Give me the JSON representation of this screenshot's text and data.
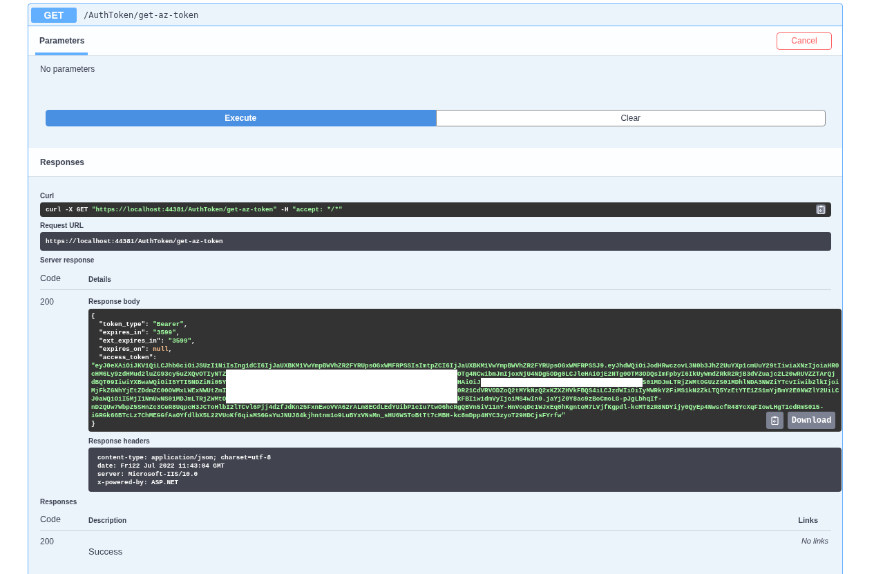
{
  "operation": {
    "method": "GET",
    "path": "/AuthToken/get-az-token"
  },
  "tabs": [
    {
      "label": "Parameters",
      "selected": true
    }
  ],
  "cancel_button": "Cancel",
  "parameters_note": "No parameters",
  "actions": [
    {
      "label": "Execute",
      "kind": "primary"
    },
    {
      "label": "Clear",
      "kind": "secondary"
    }
  ],
  "responses_heading": "Responses",
  "curl": {
    "label": "Curl",
    "parts": [
      {
        "kind": "plain",
        "text": "curl -X GET "
      },
      {
        "kind": "string",
        "text": "\"https://localhost:44381/AuthToken/get-az-token\""
      },
      {
        "kind": "plain",
        "text": " -H  "
      },
      {
        "kind": "string",
        "text": "\"accept: */*\""
      }
    ]
  },
  "request_url": {
    "label": "Request URL",
    "value": "https://localhost:44381/AuthToken/get-az-token"
  },
  "server_response": {
    "label": "Server response",
    "columns": [
      "Code",
      "Details"
    ],
    "code": "200",
    "body_label": "Response body",
    "body_lines": [
      [
        {
          "kind": "punct",
          "text": "{"
        }
      ],
      [
        {
          "kind": "key",
          "text": "  \"token_type\""
        },
        {
          "kind": "punct",
          "text": ": "
        },
        {
          "kind": "string",
          "text": "\"Bearer\""
        },
        {
          "kind": "punct",
          "text": ","
        }
      ],
      [
        {
          "kind": "key",
          "text": "  \"expires_in\""
        },
        {
          "kind": "punct",
          "text": ": "
        },
        {
          "kind": "string",
          "text": "\"3599\""
        },
        {
          "kind": "punct",
          "text": ","
        }
      ],
      [
        {
          "kind": "key",
          "text": "  \"ext_expires_in\""
        },
        {
          "kind": "punct",
          "text": ": "
        },
        {
          "kind": "string",
          "text": "\"3599\""
        },
        {
          "kind": "punct",
          "text": ","
        }
      ],
      [
        {
          "kind": "key",
          "text": "  \"expires_on\""
        },
        {
          "kind": "punct",
          "text": ": "
        },
        {
          "kind": "null",
          "text": "null"
        },
        {
          "kind": "punct",
          "text": ","
        }
      ],
      [
        {
          "kind": "key",
          "text": "  \"access_token\""
        },
        {
          "kind": "punct",
          "text": ":"
        }
      ],
      [
        {
          "kind": "string",
          "text": "\"eyJ0eXAiOiJKV1QiLCJhbGciOiJSUzI1NiIsIng1dCI6IjJaUXBKM1VwYmpBWVhZR2FYRUpsOGxWMFRPSSIsImtpZCI6IjJaUXBKM1VwYmpBWVhZR2FYRUpsOGxWMFRPSSJ9.eyJhdWQiOiJodHRwczovL3N0b3JhZ2UuYXp1cmUuY29tIiwiaXNzIjoiaHR0"
        }
      ],
      [
        {
          "kind": "string",
          "text": "cHM6Ly9zdHMud2luZG93cy5uZXQvOTIyNTZ"
        },
        {
          "kind": "redacted"
        },
        {
          "kind": "string",
          "text": "OTg4NCwibmJmIjoxNjU4NDg5ODg0LCJleHAiOjE2NTg0OTM3ODQsImFpbyI6IkUyWmdZRkR2RjB3dVZuajc2L20wRUVZZTArQj"
        }
      ],
      [
        {
          "kind": "string",
          "text": "dBQT09IiwiYXBwaWQiOiI5YTI5NDZiNi05Y"
        },
        {
          "kind": "redacted"
        },
        {
          "kind": "string",
          "text": "HAiOiJ"
        },
        {
          "kind": "redacted"
        },
        {
          "kind": "string",
          "text": "S01MDJmLTRjZWMtOGUzZS01MDhlNDA3NWZiYTcvIiwib2lkIjoi"
        }
      ],
      [
        {
          "kind": "string",
          "text": "MjFkZGNhYjEtZDdmZC00OWMxLWExNWUtZmI"
        },
        {
          "kind": "redacted"
        },
        {
          "kind": "string",
          "text": "0R21CdVRVODZoQ2tMYkNzQ2xKZXZHVkFBQS4iLCJzdWIiOiIyMWRkY2FiMS1kN2ZkLTQ5YzEtYTE1ZS1mYjBmY2E0NWZlY2UiLC"
        }
      ],
      [
        {
          "kind": "string",
          "text": "J0aWQiOiI5MjI1NmUwNS01MDJmLTRjZWMtO"
        },
        {
          "kind": "redacted"
        },
        {
          "kind": "string",
          "text": "kFBIiwidmVyIjoiMS4wIn0.jaYjZ0Y8ac9zBoCmoLG-pJgLbhqIf-"
        }
      ],
      [
        {
          "kind": "string",
          "text": "nD2QUw7WbpZ5SHnZc3CeR8UqpcH3JCToHlbI2lTCvl6Pjj4dzfJdKn25FxnEwoVVA62rALm8ECdLEdYUibP1cIu7twO6hcRgQBVn5iV11nY-HnVoqDc1WJxEq0hKgntoM7LVjfKgpdl-kcMT8zR8NDYijy0QyEp4NwscfR48YcXqFIowLHgT1cdRmS015-"
        }
      ],
      [
        {
          "kind": "string",
          "text": "iGRGk66BTcLz7ChMEGGfAaOYfdlbX5L22VUoKf6qisMS6GsYuJNUJ84kjhntnm1o9LuBYxVNsMn_sHU6WSToBtTt7cMBH-kc8mDpp4HYC3zyoT29HDCjsFYrfw\""
        }
      ],
      [
        {
          "kind": "punct",
          "text": "}"
        }
      ]
    ],
    "download_button": "Download",
    "headers_label": "Response headers",
    "headers": [
      "content-type: application/json; charset=utf-8",
      "date: Fri22 Jul 2022 11:43:04 GMT",
      "server: Microsoft-IIS/10.0",
      "x-powered-by: ASP.NET"
    ]
  },
  "responses": {
    "label": "Responses",
    "columns": [
      "Code",
      "Description",
      "Links"
    ],
    "rows": [
      {
        "code": "200",
        "description": "Success",
        "links": "No links"
      }
    ]
  }
}
